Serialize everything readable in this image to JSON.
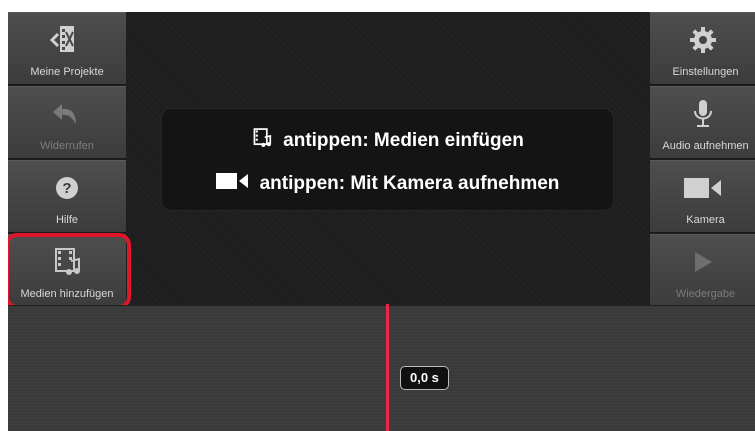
{
  "toolbar_left": {
    "projects_label": "Meine Projekte",
    "undo_label": "Widerrufen",
    "help_label": "Hilfe",
    "add_media_label": "Medien hinzufügen"
  },
  "toolbar_right": {
    "settings_label": "Einstellungen",
    "record_audio_label": "Audio aufnehmen",
    "camera_label": "Kamera",
    "playback_label": "Wiedergabe"
  },
  "hint": {
    "line1": "antippen: Medien einfügen",
    "line2": "antippen: Mit Kamera aufnehmen"
  },
  "timeline": {
    "time": "0,0 s"
  },
  "icons": {
    "projects": "projects-film-back-icon",
    "undo": "undo-arrow-icon",
    "help": "help-question-icon",
    "add_media": "film-music-icon",
    "settings": "gear-icon",
    "record_audio": "microphone-icon",
    "camera": "video-camera-icon",
    "playback": "play-icon"
  },
  "colors": {
    "highlight": "#e0162a",
    "playhead": "#e8264e"
  }
}
